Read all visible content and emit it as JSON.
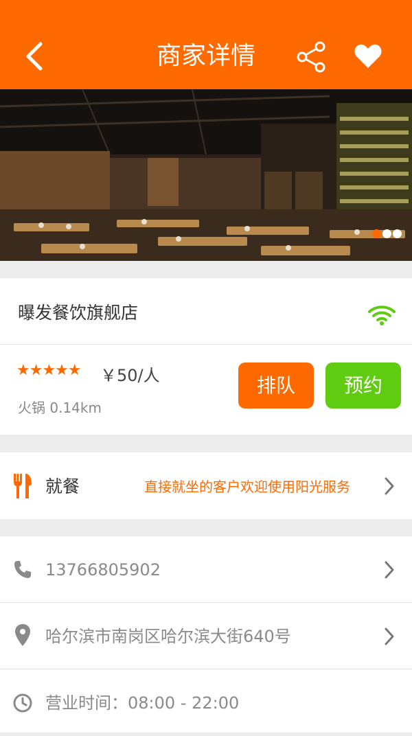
{
  "header": {
    "title": "商家详情",
    "back_icon": "chevron-left-icon",
    "share_icon": "share-icon",
    "favorite_icon": "heart-icon"
  },
  "banner": {
    "image": "restaurant-interior-photo",
    "slide_count": 3,
    "active_slide": 1
  },
  "shop": {
    "name": "曝发餐饮旗舰店",
    "wifi_icon": "wifi-icon",
    "rating_stars": "★★★★★",
    "rating": 5,
    "price": "￥50/人",
    "category": "火锅  0.14km",
    "queue_label": "排队",
    "book_label": "预约"
  },
  "dining": {
    "icon": "fork-knife-icon",
    "label": "就餐",
    "note": "直接就坐的客户欢迎使用阳光服务"
  },
  "contact": {
    "phone": "13766805902",
    "address": "哈尔滨市南岗区哈尔滨大街640号",
    "hours": "营业时间：08:00 - 22:00"
  },
  "colors": {
    "accent": "#ff6a00",
    "green": "#5fcc12",
    "background": "#ededed"
  }
}
